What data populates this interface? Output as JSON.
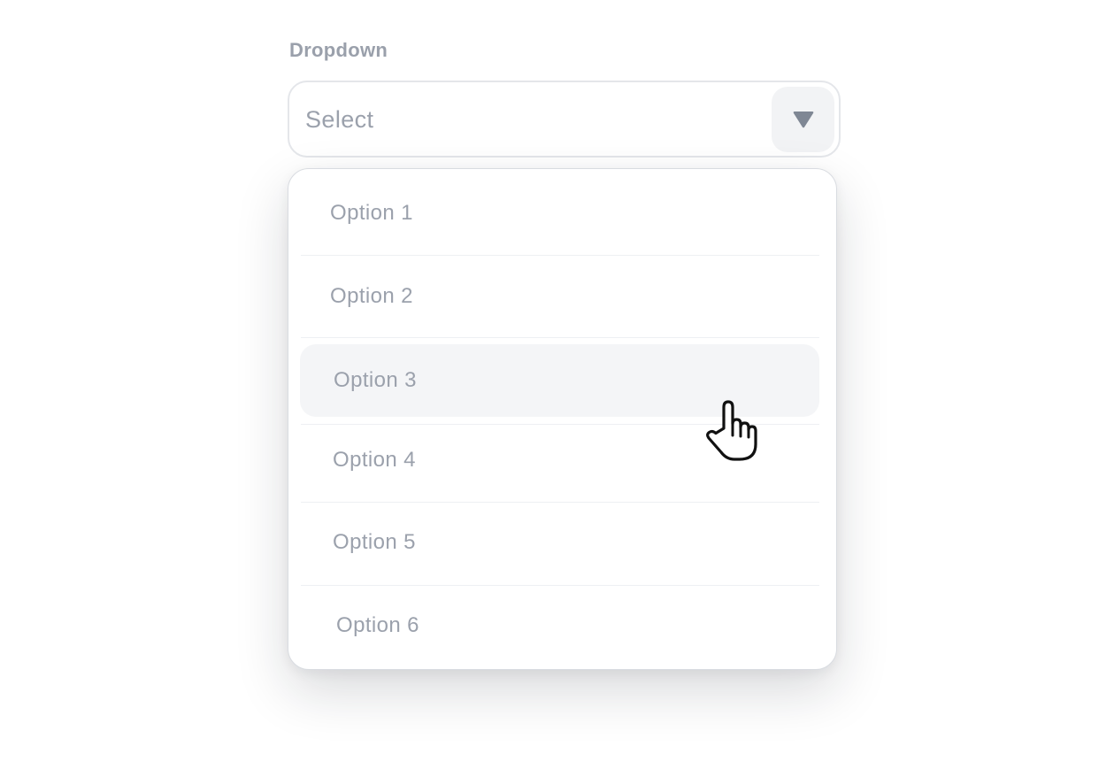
{
  "dropdown": {
    "label": "Dropdown",
    "placeholder": "Select",
    "toggle_icon": "caret-down-icon",
    "options": [
      {
        "label": "Option 1",
        "highlighted": false
      },
      {
        "label": "Option 2",
        "highlighted": false
      },
      {
        "label": "Option 3",
        "highlighted": true
      },
      {
        "label": "Option 4",
        "highlighted": false
      },
      {
        "label": "Option 5",
        "highlighted": false
      },
      {
        "label": "Option 6",
        "highlighted": false
      }
    ]
  },
  "cursor": {
    "icon": "pointer-hand-icon"
  },
  "colors": {
    "text_muted": "#9ba1ac",
    "label": "#9aa0ab",
    "border": "#e4e6ea",
    "highlight_bg": "#f4f5f7",
    "toggle_bg": "#f2f3f5",
    "caret": "#7f8794"
  }
}
